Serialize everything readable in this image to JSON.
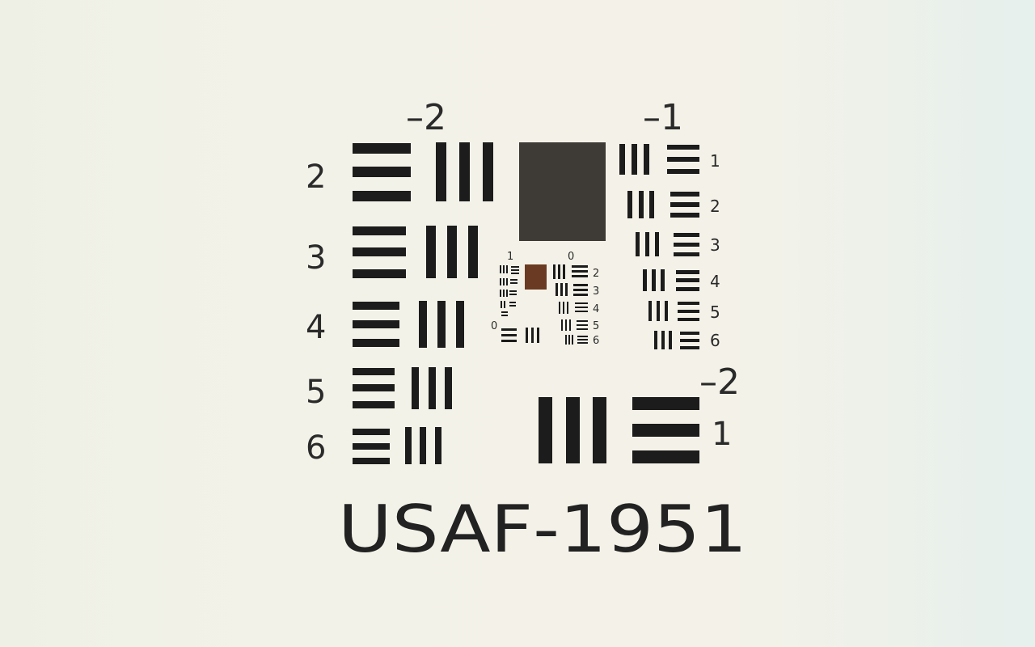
{
  "title": "USAF-1951",
  "group_labels": {
    "left": "–2",
    "top_right": "–1",
    "bottom_right": "–2"
  },
  "left_group_elements": [
    "2",
    "3",
    "4",
    "5",
    "6"
  ],
  "right_group_elements": [
    "1",
    "2",
    "3",
    "4",
    "5",
    "6"
  ],
  "bottom_right_element": "1",
  "center_group_labels": {
    "top_left": "1",
    "top_right": "0",
    "left": "0",
    "elements": [
      "2",
      "3",
      "4",
      "5",
      "6"
    ]
  },
  "colors": {
    "bars": "#1c1c1c",
    "square": "#3e3a36",
    "small_square": "#6b3a22",
    "text": "#2a2a2a"
  }
}
